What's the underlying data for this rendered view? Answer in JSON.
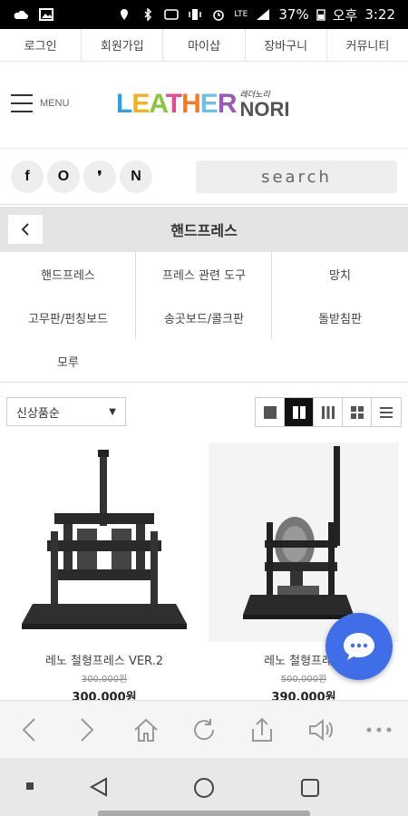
{
  "statusbar": {
    "battery": "37%",
    "ampm": "오후",
    "time": "3:22",
    "lte": "LTE"
  },
  "toplinks": [
    "로그인",
    "회원가입",
    "마이샵",
    "장바구니",
    "커뮤니티"
  ],
  "header": {
    "menu_label": "MENU",
    "logo_main": "LEATHER",
    "logo_sub_ko": "레더노리",
    "logo_sub_en": "NORI"
  },
  "social": [
    "f",
    "O",
    "❜",
    "N"
  ],
  "search": {
    "placeholder": "search"
  },
  "category": {
    "title": "핸드프레스"
  },
  "subcategories": [
    "핸드프레스",
    "프레스 관련 도구",
    "망치",
    "고무판/펀칭보드",
    "송곳보드/콜크판",
    "돌받침판",
    "모루"
  ],
  "sort": {
    "selected": "신상품순"
  },
  "products": [
    {
      "name": "레노 철형프레스 VER.2",
      "original_price": "300,000원",
      "price": "300,000원"
    },
    {
      "name": "레노 철형프레스",
      "original_price": "500,000원",
      "price": "390,000원"
    }
  ],
  "colors": {
    "accent": "#3f6ee8",
    "logo_colors": [
      "#2ea3e3",
      "#f2b21c",
      "#8bc53f",
      "#e94a8c",
      "#f47b20",
      "#6dc1e8",
      "#9b59b6"
    ]
  }
}
